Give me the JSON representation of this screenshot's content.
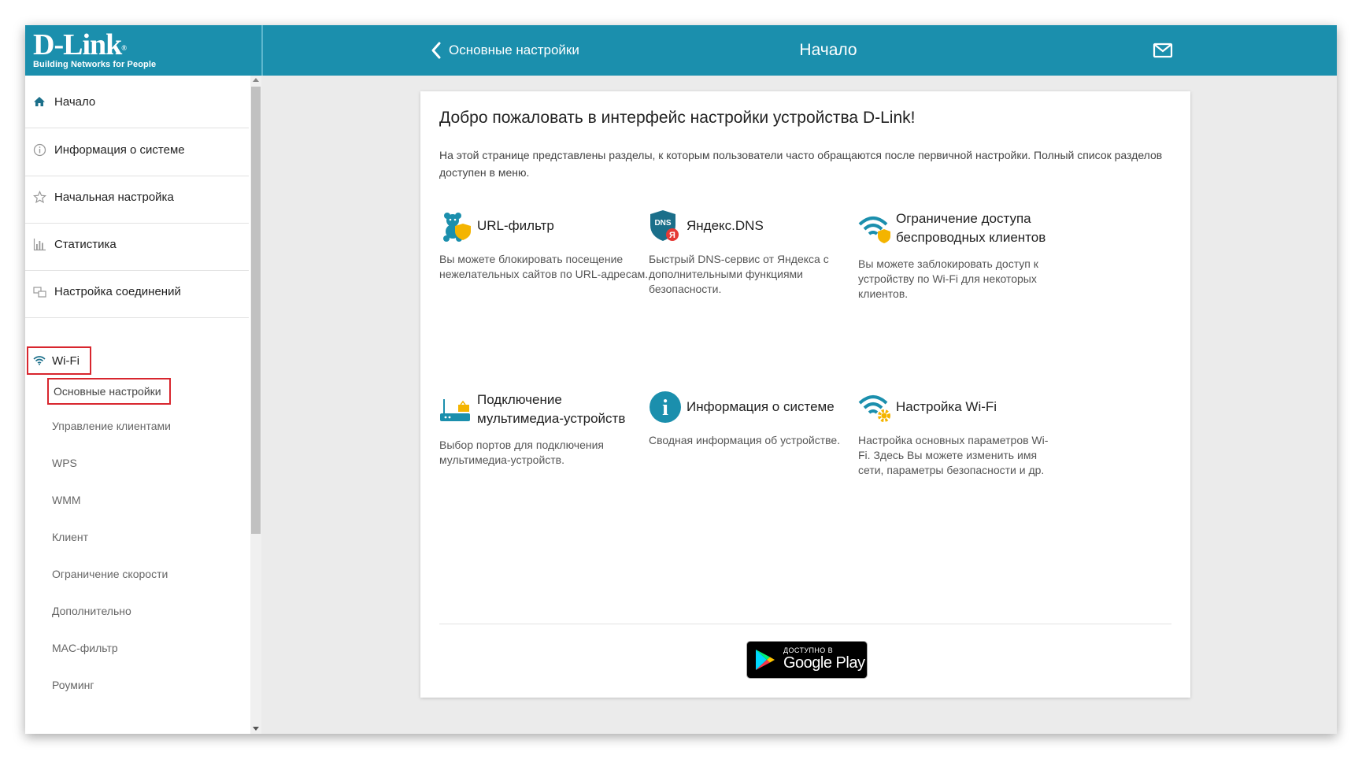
{
  "header": {
    "logo_text": "D-Link",
    "logo_tagline": "Building Networks for People",
    "back_label": "Основные настройки",
    "page_title": "Начало",
    "mail_icon": "envelope-icon"
  },
  "sidebar": {
    "items": [
      {
        "label": "Начало",
        "icon": "home-icon"
      },
      {
        "label": "Информация о системе",
        "icon": "info-icon"
      },
      {
        "label": "Начальная настройка",
        "icon": "star-icon"
      },
      {
        "label": "Статистика",
        "icon": "bar-chart-icon"
      },
      {
        "label": "Настройка соединений",
        "icon": "network-icon"
      }
    ],
    "wifi": {
      "label": "Wi-Fi",
      "icon": "wifi-icon"
    },
    "wifi_subitems": [
      "Основные настройки",
      "Управление клиентами",
      "WPS",
      "WMM",
      "Клиент",
      "Ограничение скорости",
      "Дополнительно",
      "MAC-фильтр",
      "Роуминг"
    ]
  },
  "main": {
    "welcome": "Добро пожаловать в интерфейс настройки устройства D-Link!",
    "intro": "На этой странице представлены разделы, к которым пользователи часто обращаются после первичной настройки. Полный список разделов доступен в меню.",
    "tiles": [
      {
        "title": "URL-фильтр",
        "desc": "Вы можете блокировать посещение нежелательных сайтов по URL-адресам.",
        "icon": "teddy-bear-shield-icon"
      },
      {
        "title": "Яндекс.DNS",
        "desc": "Быстрый DNS-сервис от Яндекса с дополнительными функциями безопасности.",
        "icon": "dns-shield-icon",
        "badge": "DNS",
        "badge2": "Я"
      },
      {
        "title": "Ограничение доступа беспроводных клиентов",
        "desc": "Вы можете заблокировать доступ к устройству по Wi-Fi для некоторых клиентов.",
        "icon": "wifi-shield-icon"
      },
      {
        "title": "Подключение мультимедиа-устройств",
        "desc": "Выбор портов для подключения мультимедиа-устройств.",
        "icon": "router-tv-icon"
      },
      {
        "title": "Информация о системе",
        "desc": "Сводная информация об устройстве.",
        "icon": "info-circle-icon",
        "badge": "i"
      },
      {
        "title": "Настройка Wi-Fi",
        "desc": "Настройка основных параметров Wi-Fi. Здесь Вы можете изменить имя сети, параметры безопасности и др.",
        "icon": "wifi-gear-icon"
      }
    ],
    "google_play": {
      "small": "ДОСТУПНО В",
      "big": "Google Play"
    }
  },
  "colors": {
    "header": "#1b8fad",
    "highlight": "#d8262e",
    "icon_teal": "#1b8fad",
    "icon_yellow": "#f4b400"
  }
}
